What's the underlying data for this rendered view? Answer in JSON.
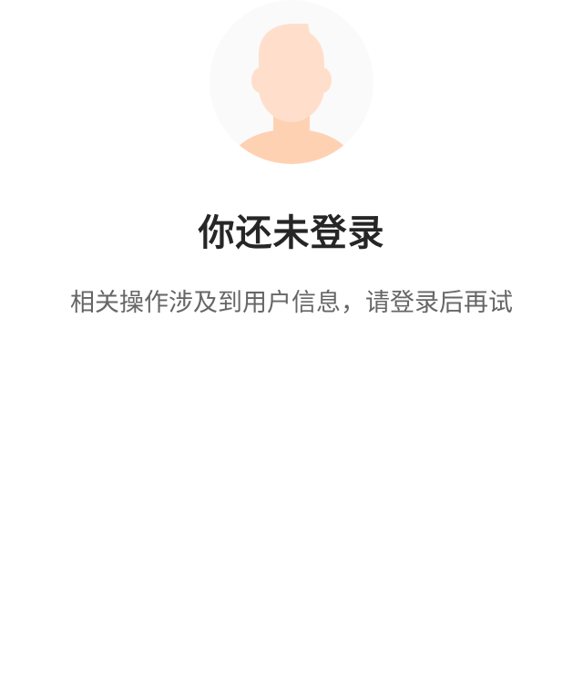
{
  "login_prompt": {
    "avatar_icon": "default-user-avatar-icon",
    "title": "你还未登录",
    "message": "相关操作涉及到用户信息，请登录后再试"
  },
  "colors": {
    "avatar_background": "#fafafa",
    "avatar_skin": "#ffdfcb",
    "avatar_shadow": "#ffd1b3",
    "title": "#262626",
    "message": "#666666"
  }
}
